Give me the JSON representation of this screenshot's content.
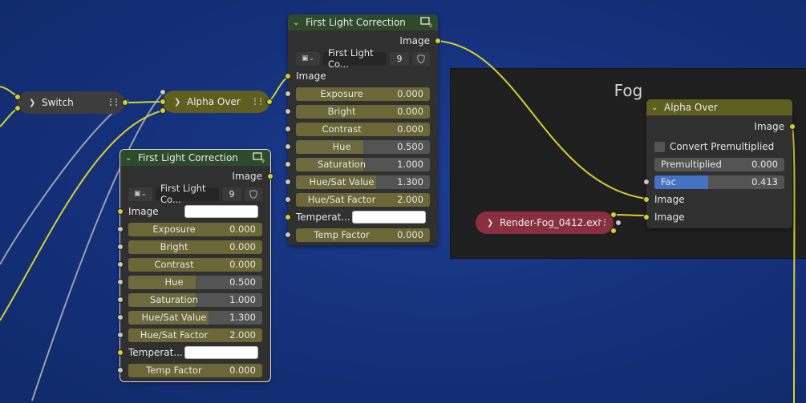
{
  "frame": {
    "label": "Fog"
  },
  "switch_node": {
    "title": "Switch"
  },
  "alpha_over_top": {
    "title": "Alpha Over"
  },
  "flc_top": {
    "title": "First Light Correction",
    "output": "Image",
    "image_name": "First Light Co...",
    "users": "9",
    "input_image": "Image",
    "rows": [
      {
        "label": "Exposure",
        "value": "0.000"
      },
      {
        "label": "Bright",
        "value": "0.000"
      },
      {
        "label": "Contrast",
        "value": "0.000"
      },
      {
        "label": "Hue",
        "value": "0.500"
      },
      {
        "label": "Saturation",
        "value": "1.000"
      },
      {
        "label": "Hue/Sat Value",
        "value": "1.300"
      },
      {
        "label": "Hue/Sat Factor",
        "value": "2.000"
      }
    ],
    "temperature_label": "Temperat...",
    "temp_factor_label": "Temp Factor",
    "temp_factor_value": "0.000"
  },
  "flc_bottom": {
    "title": "First Light Correction",
    "output": "Image",
    "image_name": "First Light Co...",
    "users": "9",
    "input_image": "Image",
    "rows": [
      {
        "label": "Exposure",
        "value": "0.000"
      },
      {
        "label": "Bright",
        "value": "0.000"
      },
      {
        "label": "Contrast",
        "value": "0.000"
      },
      {
        "label": "Hue",
        "value": "0.500"
      },
      {
        "label": "Saturation",
        "value": "1.000"
      },
      {
        "label": "Hue/Sat Value",
        "value": "1.300"
      },
      {
        "label": "Hue/Sat Factor",
        "value": "2.000"
      }
    ],
    "temperature_label": "Temperat...",
    "temp_factor_label": "Temp Factor",
    "temp_factor_value": "0.000"
  },
  "alpha_over_fog": {
    "title": "Alpha Over",
    "output": "Image",
    "convert_premultiplied": "Convert Premultiplied",
    "premultiplied_label": "Premultiplied",
    "premultiplied_value": "0.000",
    "fac_label": "Fac",
    "fac_value": "0.413",
    "fac_fraction": 0.413,
    "input1": "Image",
    "input2": "Image"
  },
  "render_fog_node": {
    "title": "Render-Fog_0412.exr"
  },
  "colors": {
    "wire": "#d4cf32",
    "wire_gray": "#9aa0ad",
    "header_green": "#2d4a2a",
    "header_olive": "#5d5e1f",
    "render_node": "#8a2f3f"
  }
}
